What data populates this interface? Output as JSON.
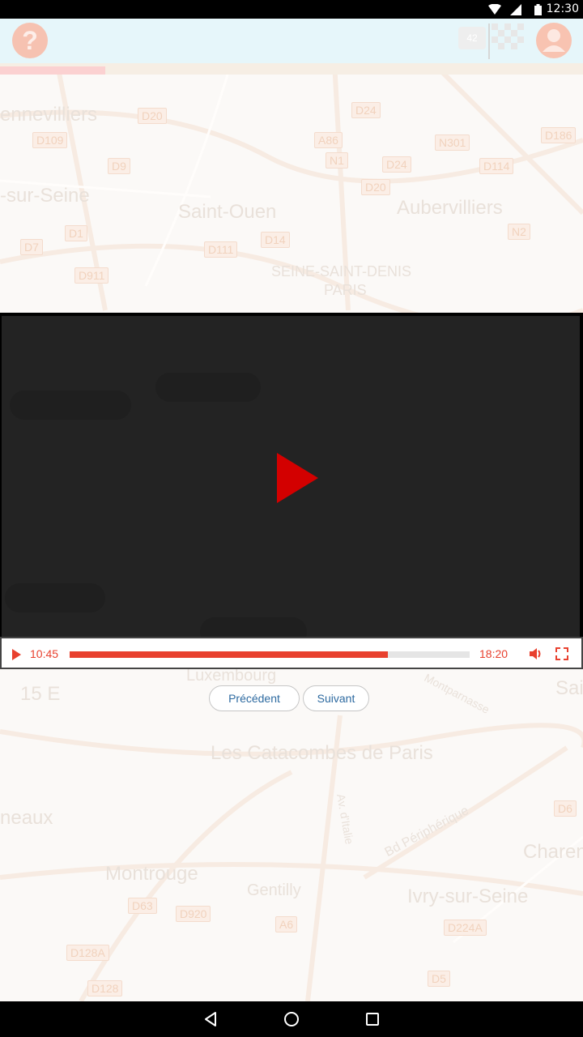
{
  "status_bar": {
    "time": "12:30"
  },
  "top_bar": {
    "help_icon": "question-mark-icon",
    "help_glyph": "?",
    "score": "42",
    "flag_icon": "checkered-flag-icon",
    "user_icon": "user-avatar-icon",
    "progress": 0.18
  },
  "map": {
    "places": [
      "ennevilliers",
      "-sur-Seine",
      "Saint-Ouen",
      "Aubervilliers",
      "SEINE-SAINT-DENIS",
      "PARIS",
      "Luxembourg",
      "Les Catacombes de Paris",
      "neaux",
      "Montrouge",
      "Gentilly",
      "Ivry-sur-Seine",
      "Charen",
      "Bd Périphérique",
      "Sai",
      "Montparnasse",
      "Av. d'Italie",
      "15 E"
    ],
    "roads": [
      "D20",
      "D109",
      "D9",
      "D1",
      "D7",
      "D911",
      "D111",
      "D14",
      "D24",
      "A86",
      "N1",
      "D20",
      "D114",
      "N301",
      "D186",
      "N2",
      "D63",
      "D920",
      "D128A",
      "D128",
      "D5",
      "D224A",
      "D6",
      "A6",
      "D24"
    ]
  },
  "video": {
    "current_time": "10:45",
    "total_time": "18:20",
    "progress": 0.795,
    "colors": {
      "accent": "#e8402e",
      "play_big": "#d30000"
    }
  },
  "buttons": {
    "previous": "Précédent",
    "next": "Suivant"
  }
}
